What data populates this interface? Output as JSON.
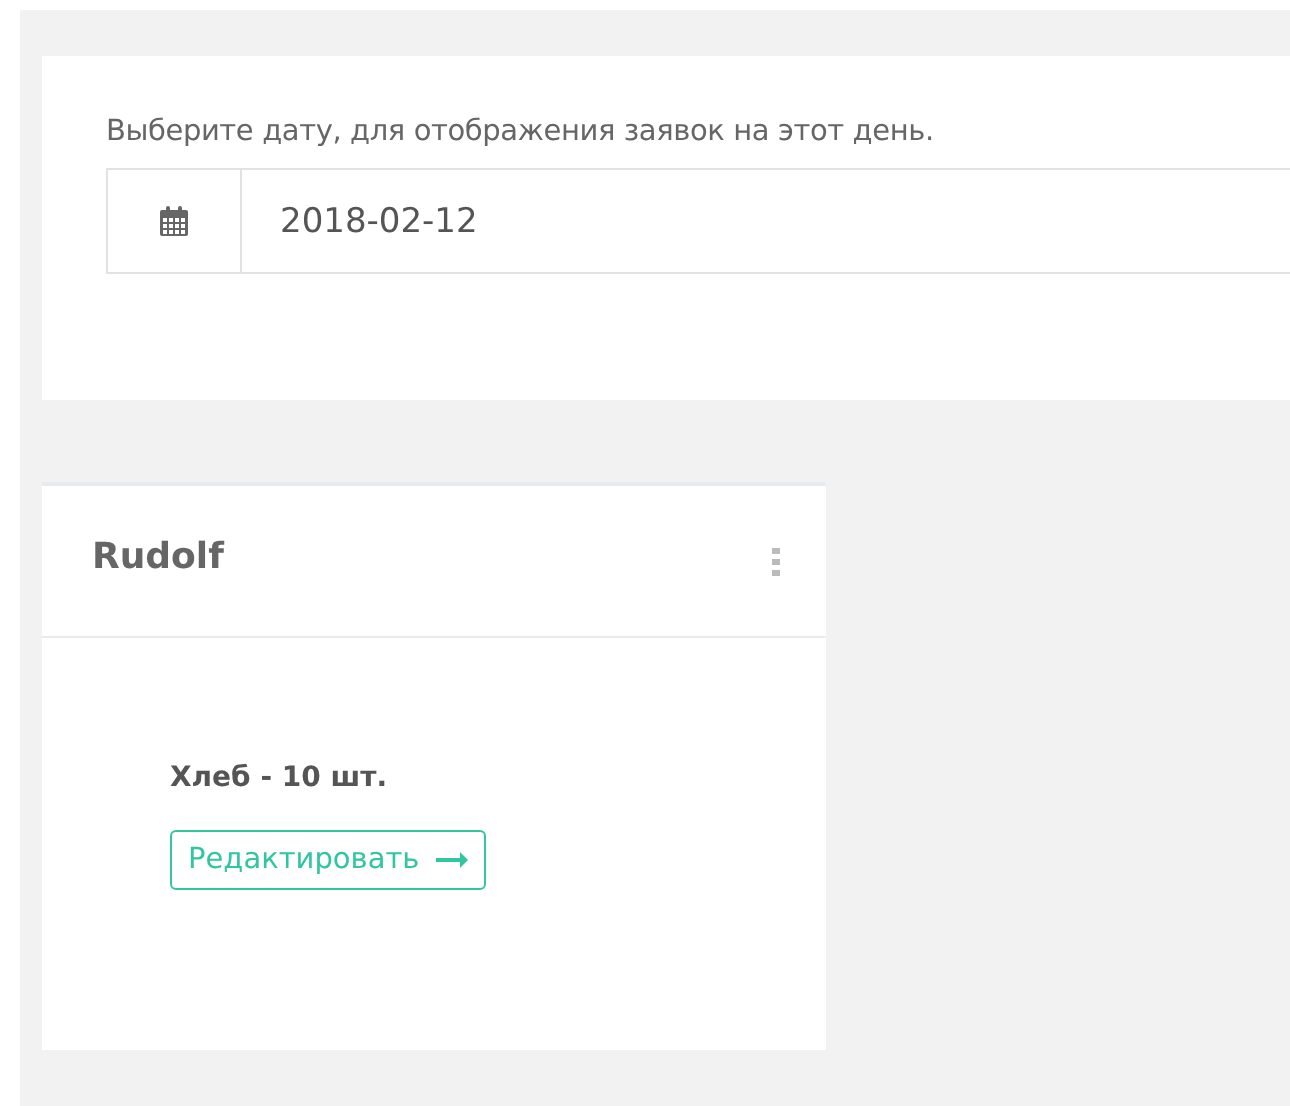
{
  "date_filter": {
    "label": "Выберите дату, для отображения заявок на этот день.",
    "value": "2018-02-12"
  },
  "orders": [
    {
      "customer": "Rudolf",
      "items": [
        "Хлеб - 10 шт."
      ],
      "edit_button": "Редактировать"
    }
  ]
}
